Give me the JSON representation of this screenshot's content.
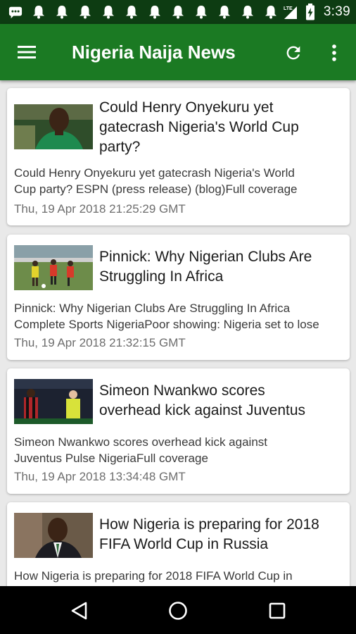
{
  "status_bar": {
    "time": "3:39",
    "network_label": "LTE",
    "icons": [
      "message-icon",
      "bell-icon",
      "bell-icon",
      "bell-icon",
      "bell-icon",
      "bell-icon",
      "bell-icon",
      "bell-icon",
      "bell-icon",
      "bell-icon",
      "bell-icon",
      "lte-signal-icon",
      "battery-charging-icon"
    ]
  },
  "app_bar": {
    "title": "Nigeria Naija News",
    "color": "#1b7a23",
    "status_color": "#0d3c12"
  },
  "articles": [
    {
      "title": [
        "Could Henry Onyekuru yet",
        "gatecrash Nigeria's World Cup",
        "party?"
      ],
      "description": [
        "Could Henry Onyekuru yet gatecrash Nigeria's World",
        "Cup party?  ESPN (press release) (blog)Full coverage"
      ],
      "date": "Thu, 19 Apr 2018 21:25:29 GMT"
    },
    {
      "title": [
        "Pinnick: Why Nigerian Clubs Are",
        "Struggling In Africa"
      ],
      "description": [
        "Pinnick: Why Nigerian Clubs Are Struggling In Africa",
        "Complete Sports NigeriaPoor showing: Nigeria set to lose"
      ],
      "date": "Thu, 19 Apr 2018 21:32:15 GMT"
    },
    {
      "title": [
        "Simeon Nwankwo scores",
        "overhead kick against Juventus"
      ],
      "description": [
        "Simeon Nwankwo scores overhead kick against",
        "Juventus  Pulse NigeriaFull coverage"
      ],
      "date": "Thu, 19 Apr 2018 13:34:48 GMT"
    },
    {
      "title": [
        "How Nigeria is preparing for 2018",
        "FIFA World Cup in Russia"
      ],
      "description": [
        "How Nigeria is preparing for 2018 FIFA World Cup in"
      ],
      "date": ""
    }
  ]
}
